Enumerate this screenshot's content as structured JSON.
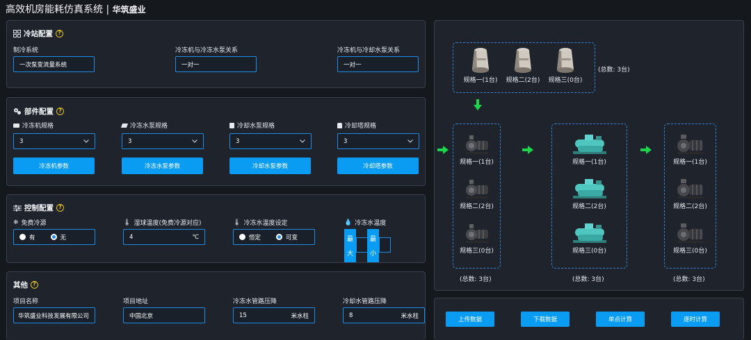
{
  "app": {
    "title": "高效机房能耗仿真系统",
    "brand": "华筑盛业"
  },
  "station": {
    "title": "冷站配置",
    "fields": [
      {
        "label": "制冷系统",
        "value": "一次泵变流量系统"
      },
      {
        "label": "冷冻机与冷冻水泵关系",
        "value": "一对一"
      },
      {
        "label": "冷冻机与冷却水泵关系",
        "value": "一对一"
      }
    ]
  },
  "parts": {
    "title": "部件配置",
    "cols": [
      {
        "label": "冷冻机规格",
        "value": "3",
        "button": "冷冻机参数",
        "icon": "chiller-icon"
      },
      {
        "label": "冷冻水泵规格",
        "value": "3",
        "button": "冷冻水泵参数",
        "icon": "pump-icon"
      },
      {
        "label": "冷却水泵规格",
        "value": "3",
        "button": "冷却水泵参数",
        "icon": "pump-icon"
      },
      {
        "label": "冷却塔规格",
        "value": "3",
        "button": "冷却塔参数",
        "icon": "tower-icon"
      }
    ]
  },
  "control": {
    "title": "控制配置",
    "free_cooling": {
      "label": "免费冷源",
      "opt1": "有",
      "opt2": "无"
    },
    "wetbulb": {
      "label": "湿球温度(免费冷源对应)",
      "value": "4",
      "unit": "℃"
    },
    "chw_temp_set": {
      "label": "冷冻水温度设定",
      "opt1": "恒定",
      "opt2": "可变"
    },
    "chw_temp": {
      "label": "冷冻水温度",
      "max1": "最",
      "max2": "大",
      "min1": "最",
      "min2": "小"
    }
  },
  "other": {
    "title": "其他",
    "fields": [
      {
        "label": "项目名称",
        "value": "华筑盛业科技发展有限公司",
        "unit": ""
      },
      {
        "label": "项目地址",
        "value": "中国北京",
        "unit": ""
      },
      {
        "label": "冷冻水管路压降",
        "value": "15",
        "unit": "米水柱"
      },
      {
        "label": "冷却水管路压降",
        "value": "8",
        "unit": "米水柱"
      }
    ]
  },
  "diagram": {
    "towers": {
      "items": [
        "规格一(1台)",
        "规格二(2台)",
        "规格三(0台)"
      ],
      "total": "(总数: 3台)"
    },
    "group1": {
      "items": [
        "规格一(1台)",
        "规格二(2台)",
        "规格三(0台)"
      ],
      "total": "(总数: 3台)"
    },
    "group2": {
      "items": [
        "规格一(1台)",
        "规格二(2台)",
        "规格三(0台)"
      ],
      "total": "(总数: 3台)"
    },
    "group3": {
      "items": [
        "规格一(1台)",
        "规格二(2台)",
        "规格三(0台)"
      ],
      "total": "(总数: 3台)"
    }
  },
  "actions": [
    "上传数据",
    "下载数据",
    "单点计算",
    "逐时计算"
  ],
  "colors": {
    "accent": "#0a9cf2",
    "help": "#e8c21f",
    "arrow": "#19d64b",
    "chiller": "#4fc6c0"
  }
}
